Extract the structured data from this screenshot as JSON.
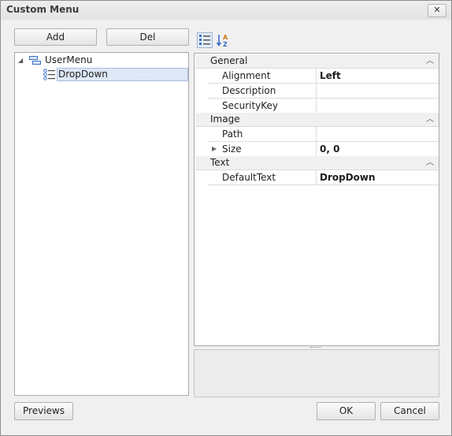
{
  "window": {
    "title": "Custom Menu",
    "close_label": "✕"
  },
  "toolbar": {
    "add_label": "Add",
    "del_label": "Del"
  },
  "tree": {
    "items": [
      {
        "label": "UserMenu",
        "expanded": true
      },
      {
        "label": "DropDown",
        "selected": true
      }
    ]
  },
  "property_toolbar": {
    "categorized_icon": "categorized-icon",
    "alphabetical_icon": "alphabetical-sort-icon"
  },
  "properties": {
    "categories": [
      {
        "name": "General",
        "rows": [
          {
            "name": "Alignment",
            "value": "Left"
          },
          {
            "name": "Description",
            "value": ""
          },
          {
            "name": "SecurityKey",
            "value": ""
          }
        ]
      },
      {
        "name": "Image",
        "rows": [
          {
            "name": "Path",
            "value": ""
          },
          {
            "name": "Size",
            "value": "0, 0",
            "expandable": true
          }
        ]
      },
      {
        "name": "Text",
        "rows": [
          {
            "name": "DefaultText",
            "value": "DropDown"
          }
        ]
      }
    ]
  },
  "footer": {
    "previews_label": "Previews",
    "ok_label": "OK",
    "cancel_label": "Cancel"
  },
  "colors": {
    "selection": "#dde8f8",
    "selection_border": "#6f8fc0",
    "accent_blue": "#3a6fc4"
  }
}
